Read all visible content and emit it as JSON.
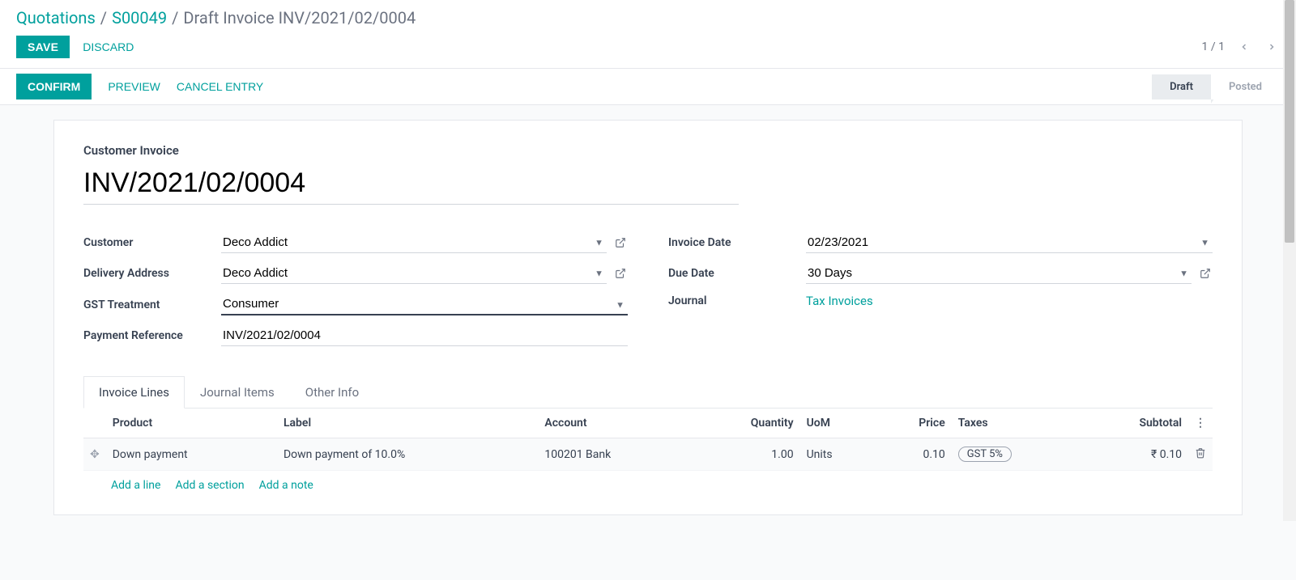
{
  "breadcrumb": {
    "root": "Quotations",
    "order": "S00049",
    "current": "Draft Invoice INV/2021/02/0004"
  },
  "cp": {
    "save": "Save",
    "discard": "Discard",
    "pager": "1 / 1"
  },
  "statusbar": {
    "confirm": "Confirm",
    "preview": "Preview",
    "cancel_entry": "Cancel Entry",
    "draft": "Draft",
    "posted": "Posted"
  },
  "header": {
    "section_label": "Customer Invoice",
    "title": "INV/2021/02/0004"
  },
  "fields": {
    "customer_label": "Customer",
    "customer_value": "Deco Addict",
    "delivery_label": "Delivery Address",
    "delivery_value": "Deco Addict",
    "gst_label": "GST Treatment",
    "gst_value": "Consumer",
    "payref_label": "Payment Reference",
    "payref_value": "INV/2021/02/0004",
    "invoice_date_label": "Invoice Date",
    "invoice_date_value": "02/23/2021",
    "due_date_label": "Due Date",
    "due_date_value": "30 Days",
    "journal_label": "Journal",
    "journal_value": "Tax Invoices"
  },
  "tabs": {
    "invoice_lines": "Invoice Lines",
    "journal_items": "Journal Items",
    "other_info": "Other Info"
  },
  "table": {
    "headers": {
      "product": "Product",
      "label": "Label",
      "account": "Account",
      "quantity": "Quantity",
      "uom": "UoM",
      "price": "Price",
      "taxes": "Taxes",
      "subtotal": "Subtotal"
    },
    "rows": [
      {
        "product": "Down payment",
        "label": "Down payment of 10.0%",
        "account": "100201 Bank",
        "quantity": "1.00",
        "uom": "Units",
        "price": "0.10",
        "taxes": "GST 5%",
        "subtotal": "₹ 0.10"
      }
    ],
    "add_line": "Add a line",
    "add_section": "Add a section",
    "add_note": "Add a note"
  }
}
